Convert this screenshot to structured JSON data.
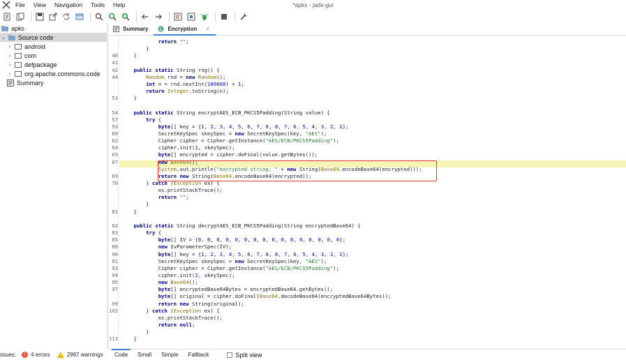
{
  "window": {
    "title": "*apks - jadx-gui"
  },
  "menu": [
    "File",
    "View",
    "Navigation",
    "Tools",
    "Help"
  ],
  "toolbar_icons": [
    "open-file-icon",
    "add-files-icon",
    "save-all-icon",
    "export-icon",
    "sync-icon",
    "flatten-icon",
    "search-icon",
    "search-class-icon",
    "find-usage-icon",
    "back-icon",
    "forward-icon",
    "deobfuscation-icon",
    "quark-icon",
    "log-icon",
    "debug-icon",
    "preferences-icon"
  ],
  "tree": {
    "root": "apks",
    "source_code": "Source code",
    "packages": [
      "android",
      "com",
      "defpackage",
      "org.apache.commons.code"
    ],
    "summary": "Summary"
  },
  "tabs": [
    {
      "label": "Summary",
      "active": false
    },
    {
      "label": "Encryption",
      "active": true
    }
  ],
  "code_lines": [
    {
      "n": "",
      "code": "            <kw>return</kw> <str>\"\"</str>;"
    },
    {
      "n": "",
      "code": "        }"
    },
    {
      "n": "40",
      "code": "    }"
    },
    {
      "n": "41",
      "code": ""
    },
    {
      "n": "42",
      "code": "    <kw>public static</kw> <ty>String</ty> rng() {"
    },
    {
      "n": "44",
      "code": "        <cls>Random</cls> rnd = <kw>new</kw> <cls>Random</cls>();"
    },
    {
      "n": "",
      "code": "        <kw>int</kw> n = rnd.nextInt(<num>100000</num>) + <num>1</num>;"
    },
    {
      "n": "",
      "code": "        <kw>return</kw> <cls>Integer</cls>.toString(n);"
    },
    {
      "n": "53",
      "code": "    }"
    },
    {
      "n": "",
      "code": ""
    },
    {
      "n": "54",
      "code": "    <kw>public static</kw> <ty>String</ty> encryptAES_ECB_PKCS5Padding(<ty>String</ty> value) {"
    },
    {
      "n": "57",
      "code": "        <kw>try</kw> {"
    },
    {
      "n": "59",
      "code": "            <kw>byte</kw>[] key = {<num>1</num>, <num>2</num>, <num>3</num>, <num>4</num>, <num>5</num>, <num>6</num>, <num>7</num>, <num>8</num>, <num>8</num>, <num>7</num>, <num>6</num>, <num>5</num>, <num>4</num>, <num>3</num>, <num>2</num>, <num>1</num>};"
    },
    {
      "n": "60",
      "code": "            SecretKeySpec skeySpec = <kw>new</kw> SecretKeySpec(key, <str>\"AES\"</str>);"
    },
    {
      "n": "62",
      "code": "            Cipher cipher = Cipher.getInstance(<str>\"AES/ECB/PKCS5Padding\"</str>);"
    },
    {
      "n": "64",
      "code": "            cipher.init(<num>1</num>, skeySpec);"
    },
    {
      "n": "65",
      "code": "            <kw>byte</kw>[] encrypted = cipher.doFinal(value.getBytes());"
    },
    {
      "n": "67",
      "code": "            <kw>new</kw> <cls>Base64</cls>();"
    },
    {
      "n": "",
      "code": "            <cls>System</cls>.out.println(<str>\"encrypted string: \"</str> + <kw>new</kw> <ty>String</ty>(<cls>Base64</cls>.encodeBase64(encrypted)));"
    },
    {
      "n": "69",
      "code": "            <kw>return new</kw> <ty>String</ty>(<cls>Base64</cls>.encodeBase64(encrypted));"
    },
    {
      "n": "70",
      "code": "        } <kw>catch</kw> (<cls>Exception</cls> ex) {"
    },
    {
      "n": "",
      "code": "            ex.printStackTrace();"
    },
    {
      "n": "",
      "code": "            <kw>return</kw> <str>\"\"</str>;"
    },
    {
      "n": "",
      "code": "        }"
    },
    {
      "n": "81",
      "code": "    }"
    },
    {
      "n": "",
      "code": ""
    },
    {
      "n": "82",
      "code": "    <kw>public static</kw> <ty>String</ty> decryptAES_ECB_PKCS5Padding(<ty>String</ty> encryptedBase64) {"
    },
    {
      "n": "83",
      "code": "        <kw>try</kw> {"
    },
    {
      "n": "85",
      "code": "            <kw>byte</kw>[] IV = {<num>0</num>, <num>0</num>, <num>0</num>, <num>0</num>, <num>0</num>, <num>0</num>, <num>0</num>, <num>0</num>, <num>0</num>, <num>0</num>, <num>0</num>, <num>0</num>, <num>0</num>, <num>0</num>, <num>0</num>, <num>0</num>};"
    },
    {
      "n": "88",
      "code": "            <kw>new</kw> IvParameterSpec(IV);"
    },
    {
      "n": "90",
      "code": "            <kw>byte</kw>[] key = {<num>1</num>, <num>2</num>, <num>3</num>, <num>4</num>, <num>5</num>, <num>6</num>, <num>7</num>, <num>8</num>, <num>8</num>, <num>7</num>, <num>6</num>, <num>5</num>, <num>4</num>, <num>3</num>, <num>2</num>, <num>1</num>};"
    },
    {
      "n": "91",
      "code": "            SecretKeySpec skeySpec = <kw>new</kw> SecretKeySpec(key, <str>\"AES\"</str>);"
    },
    {
      "n": "93",
      "code": "            Cipher cipher = Cipher.getInstance(<str>\"AES/ECB/PKCS5Padding\"</str>);"
    },
    {
      "n": "94",
      "code": "            cipher.init(<num>2</num>, skeySpec);"
    },
    {
      "n": "95",
      "code": "            <kw>new</kw> <cls>Base64</cls>();"
    },
    {
      "n": "97",
      "code": "            <kw>byte</kw>[] encryptedBase64Bytes = encryptedBase64.getBytes();"
    },
    {
      "n": "",
      "code": "            <kw>byte</kw>[] original = cipher.doFinal(<cls>Base64</cls>.decodeBase64(encryptedBase64Bytes));"
    },
    {
      "n": "99",
      "code": "            <kw>return new</kw> <ty>String</ty>(original);"
    },
    {
      "n": "102",
      "code": "        } <kw>catch</kw> (<cls>Exception</cls> ex) {"
    },
    {
      "n": "",
      "code": "            ex.printStackTrace();"
    },
    {
      "n": "",
      "code": "            <kw>return null</kw>;"
    },
    {
      "n": "",
      "code": "        }"
    },
    {
      "n": "113",
      "code": "    }"
    }
  ],
  "bottom_tabs": [
    {
      "label": "Code",
      "active": true
    },
    {
      "label": "Smali",
      "active": false
    },
    {
      "label": "Simple",
      "active": false
    },
    {
      "label": "Fallback",
      "active": false
    }
  ],
  "split_view_label": "Split view",
  "status": {
    "issues_label": "ssues:",
    "errors": "4 errors",
    "warnings": "2997 warnings"
  }
}
